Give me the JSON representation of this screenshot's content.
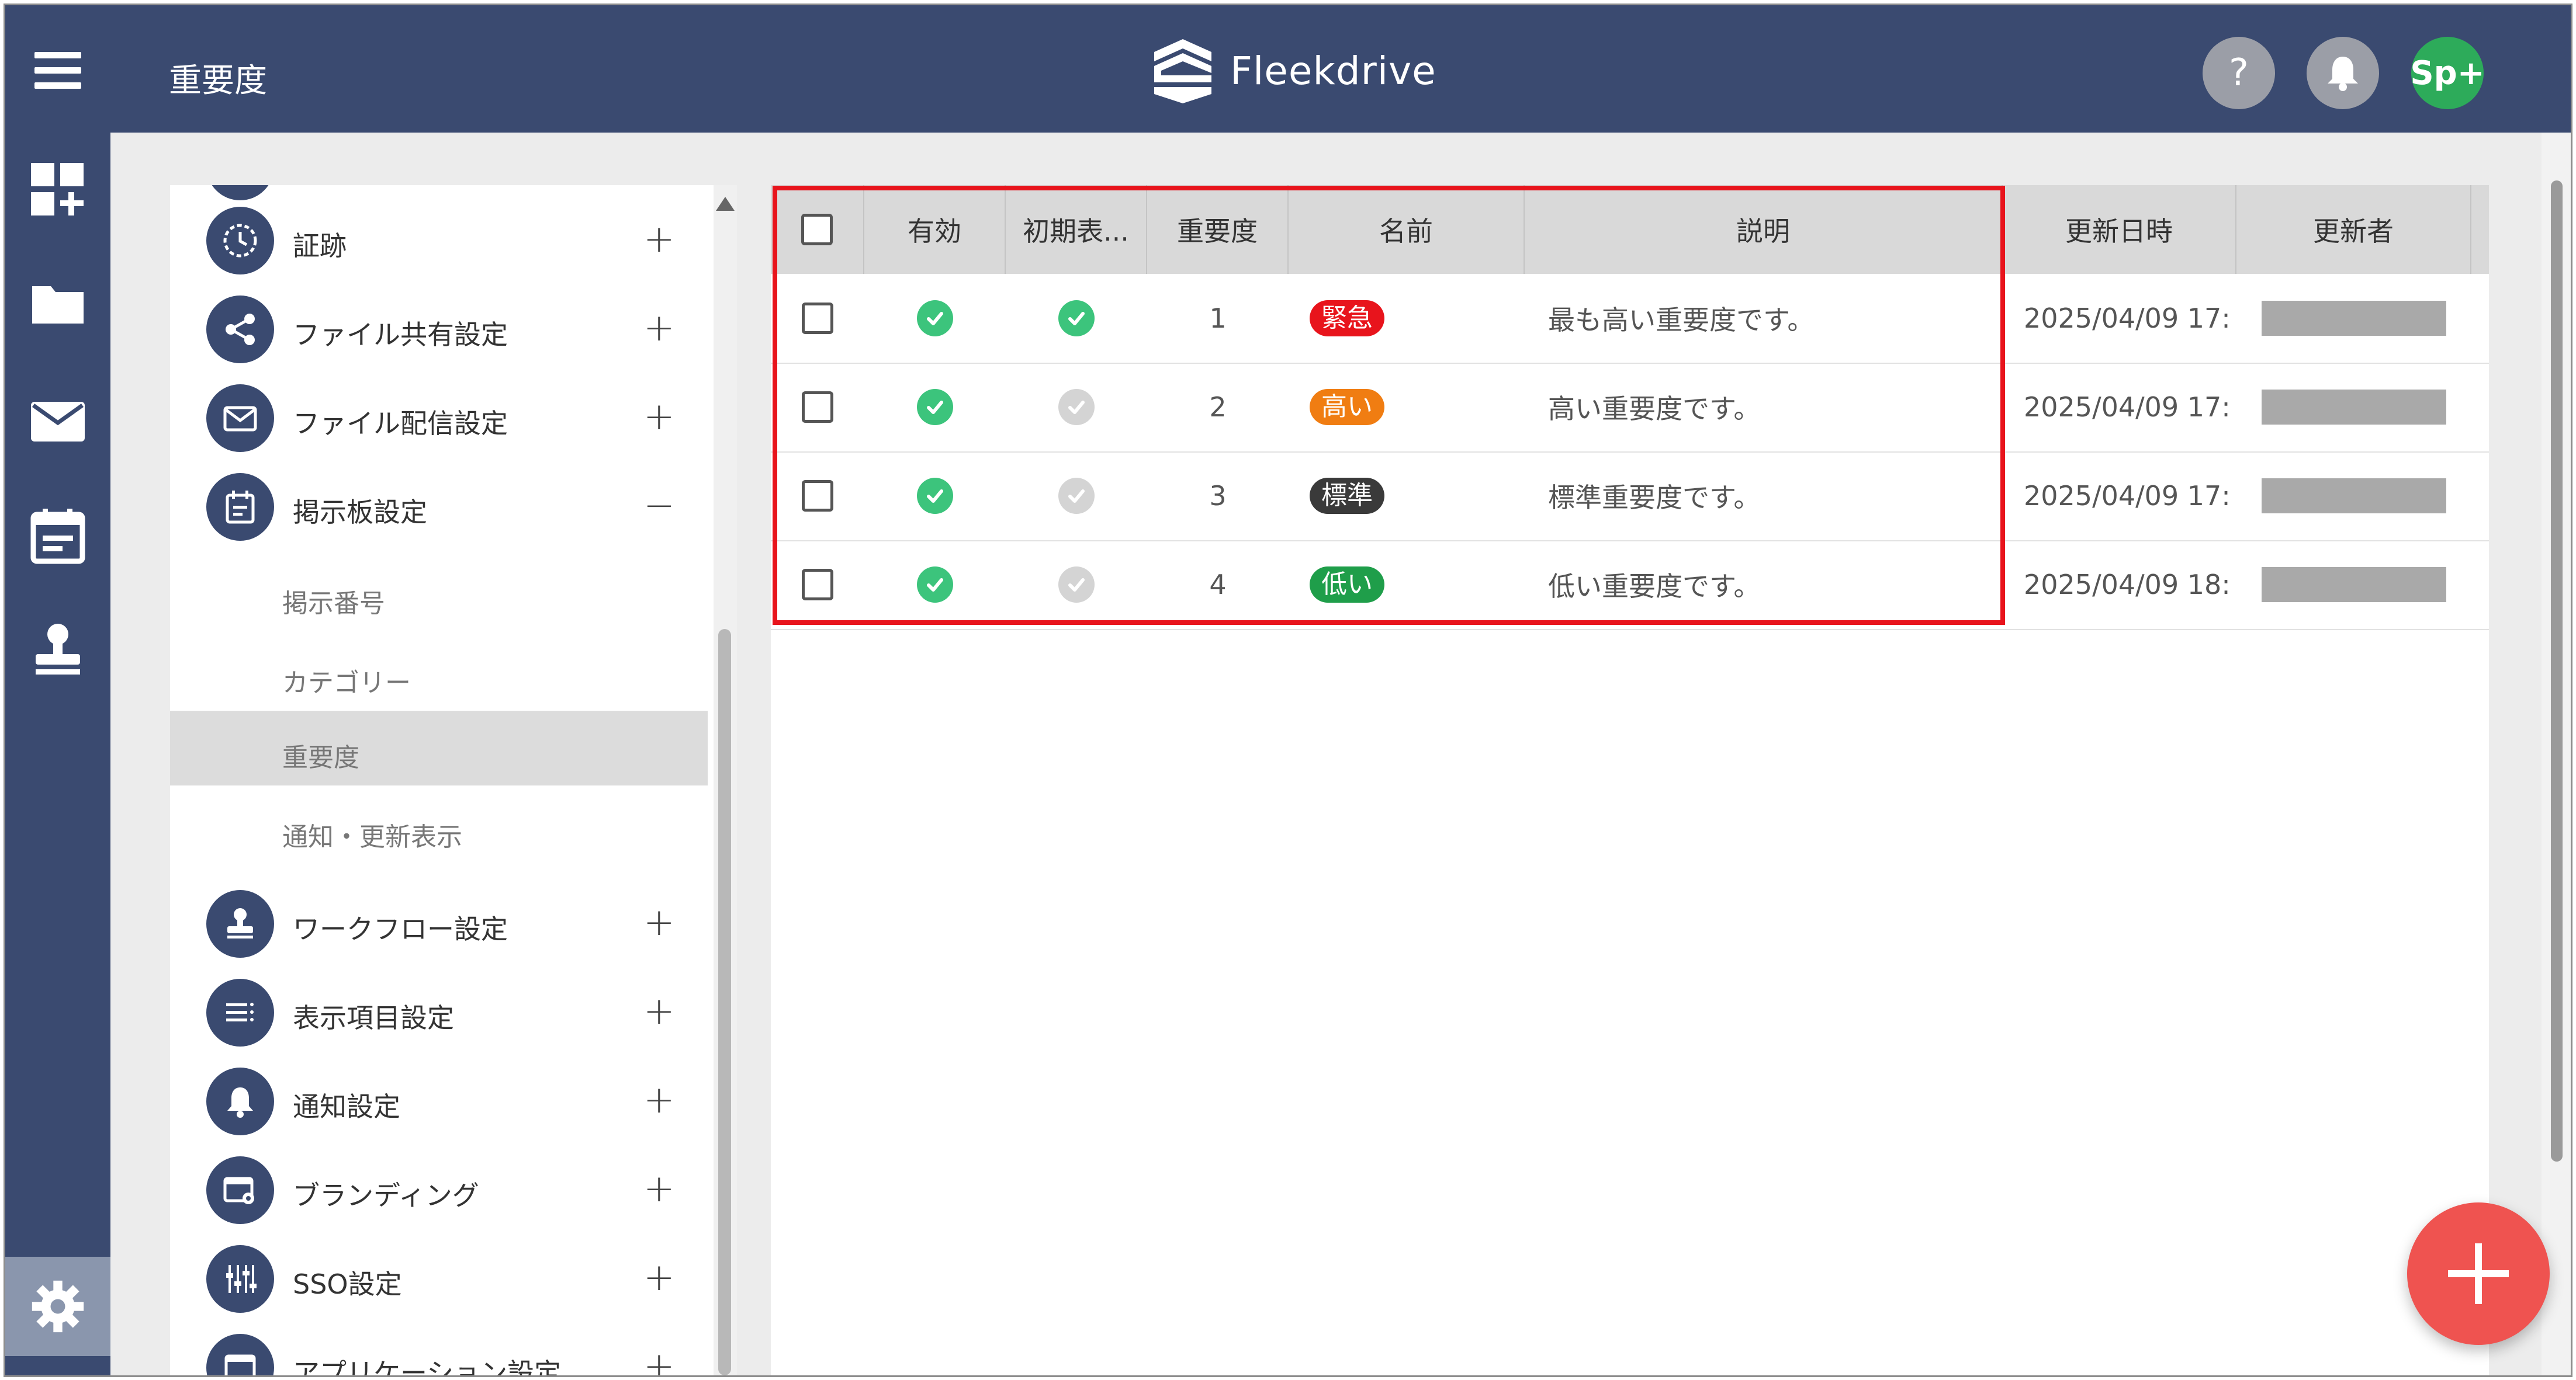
{
  "header": {
    "page_title": "重要度",
    "brand_name": "Fleekdrive",
    "help_label": "?",
    "avatar_text": "Sp+"
  },
  "rail": {
    "icons": [
      "dashboard-add-icon",
      "folder-icon",
      "mail-icon",
      "calendar-icon",
      "stamp-icon",
      "gear-icon"
    ]
  },
  "nav": {
    "items": [
      {
        "label": "証跡",
        "toggle": "+",
        "icon": "clock-icon"
      },
      {
        "label": "ファイル共有設定",
        "toggle": "+",
        "icon": "share-icon"
      },
      {
        "label": "ファイル配信設定",
        "toggle": "+",
        "icon": "mail-icon"
      },
      {
        "label": "掲示板設定",
        "toggle": "−",
        "icon": "board-icon"
      },
      {
        "label": "ワークフロー設定",
        "toggle": "+",
        "icon": "stamp-icon"
      },
      {
        "label": "表示項目設定",
        "toggle": "+",
        "icon": "list-icon"
      },
      {
        "label": "通知設定",
        "toggle": "+",
        "icon": "bell-icon"
      },
      {
        "label": "ブランディング",
        "toggle": "+",
        "icon": "branding-icon"
      },
      {
        "label": "SSO設定",
        "toggle": "+",
        "icon": "sliders-icon"
      },
      {
        "label": "アプリケーション設定",
        "toggle": "+",
        "icon": "app-icon"
      }
    ],
    "sub_items": [
      "掲示番号",
      "カテゴリー",
      "重要度",
      "通知・更新表示"
    ]
  },
  "table": {
    "columns": [
      "有効",
      "初期表...",
      "重要度",
      "名前",
      "説明",
      "更新日時",
      "更新者"
    ],
    "rows": [
      {
        "enabled": true,
        "default": true,
        "level": "1",
        "name": "緊急",
        "color": "#e8141c",
        "description": "最も高い重要度です。",
        "updated": "2025/04/09 17:"
      },
      {
        "enabled": true,
        "default": false,
        "level": "2",
        "name": "高い",
        "color": "#f07d12",
        "description": "高い重要度です。",
        "updated": "2025/04/09 17:"
      },
      {
        "enabled": true,
        "default": false,
        "level": "3",
        "name": "標準",
        "color": "#3a3a3a",
        "description": "標準重要度です。",
        "updated": "2025/04/09 17:"
      },
      {
        "enabled": true,
        "default": false,
        "level": "4",
        "name": "低い",
        "color": "#1f9e4a",
        "description": "低い重要度です。",
        "updated": "2025/04/09 18:"
      }
    ]
  },
  "colors": {
    "header_bg": "#3a4a70",
    "highlight": "#e8141c",
    "fab": "#ef5350"
  }
}
